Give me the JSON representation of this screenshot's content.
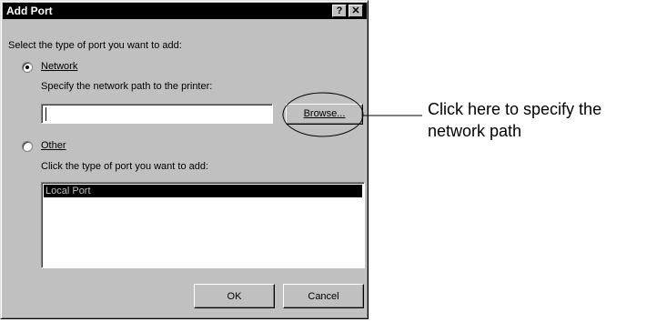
{
  "dialog": {
    "title": "Add Port",
    "help_button": "?",
    "close_button": "✕",
    "prompt": "Select the type of port you want to add:",
    "network": {
      "label": "Network",
      "selected": true,
      "path_label": "Specify the network path to the printer:",
      "path_value": "",
      "browse_label": "Browse..."
    },
    "other": {
      "label": "Other",
      "selected": false,
      "list_label": "Click the type of port you want to add:",
      "items": [
        "Local Port"
      ]
    },
    "ok_label": "OK",
    "cancel_label": "Cancel"
  },
  "callout": {
    "line1": "Click here to specify the",
    "line2": "network path"
  }
}
